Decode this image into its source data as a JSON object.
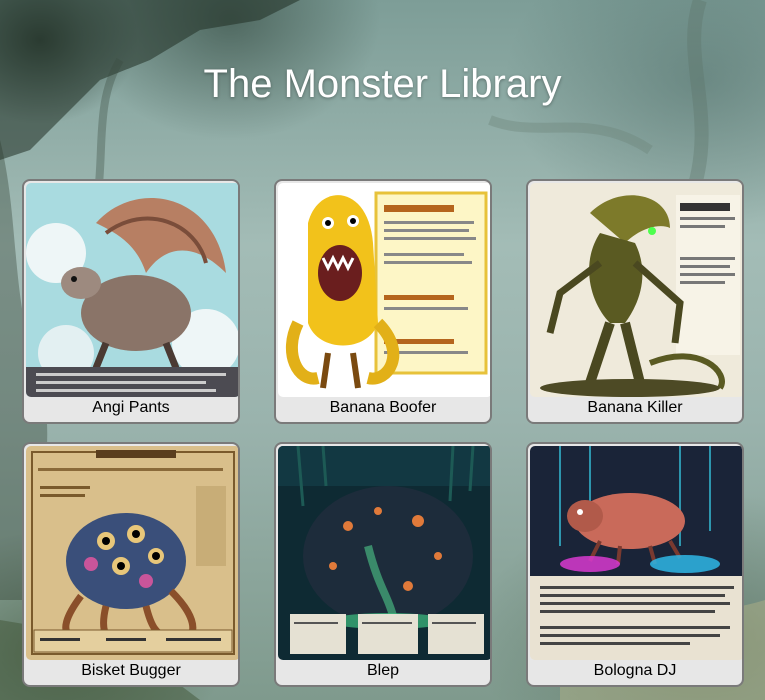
{
  "header": {
    "title": "The Monster Library"
  },
  "monsters": [
    {
      "name": "Angi Pants",
      "image": "winged-feathered-beast-illustration"
    },
    {
      "name": "Banana Boofer",
      "image": "banana-monster-illustration"
    },
    {
      "name": "Banana Killer",
      "image": "plant-creature-illustration"
    },
    {
      "name": "Bisket Bugger",
      "image": "tentacled-many-eyed-creature-illustration"
    },
    {
      "name": "Blep",
      "image": "dark-blob-creature-illustration"
    },
    {
      "name": "Bologna DJ",
      "image": "pink-insect-turntable-illustration"
    }
  ]
}
